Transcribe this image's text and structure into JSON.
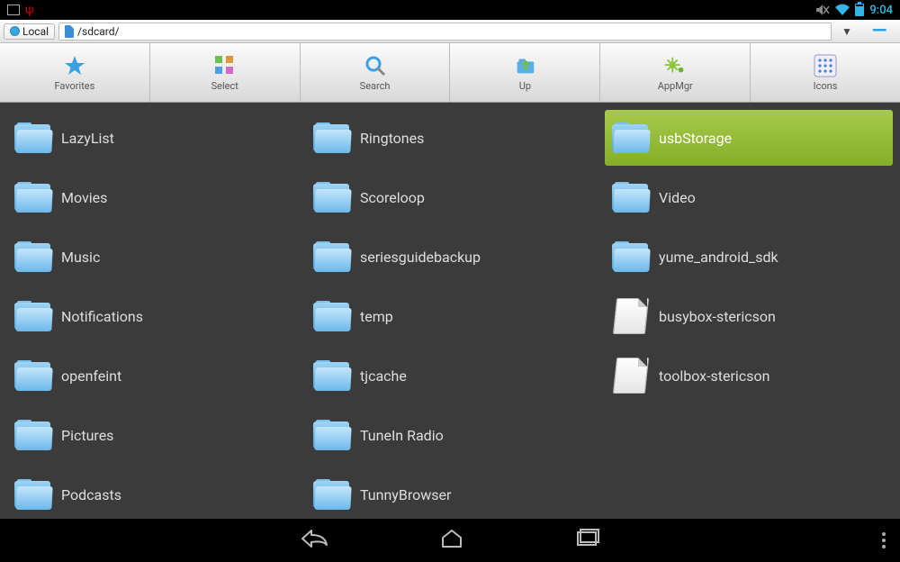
{
  "status": {
    "clock": "9:04"
  },
  "location": {
    "local_label": "Local",
    "path": "/sdcard/"
  },
  "toolbar": [
    {
      "name": "favorites",
      "label": "Favorites"
    },
    {
      "name": "select",
      "label": "Select"
    },
    {
      "name": "search",
      "label": "Search"
    },
    {
      "name": "up",
      "label": "Up"
    },
    {
      "name": "appmgr",
      "label": "AppMgr"
    },
    {
      "name": "icons",
      "label": "Icons"
    }
  ],
  "items": [
    {
      "n": "LazyList",
      "t": "folder",
      "s": false
    },
    {
      "n": "Movies",
      "t": "folder",
      "s": false
    },
    {
      "n": "Music",
      "t": "folder",
      "s": false
    },
    {
      "n": "Notifications",
      "t": "folder",
      "s": false
    },
    {
      "n": "openfeint",
      "t": "folder",
      "s": false
    },
    {
      "n": "Pictures",
      "t": "folder",
      "s": false
    },
    {
      "n": "Podcasts",
      "t": "folder",
      "s": false
    },
    {
      "n": "Ringtones",
      "t": "folder",
      "s": false
    },
    {
      "n": "Scoreloop",
      "t": "folder",
      "s": false
    },
    {
      "n": "seriesguidebackup",
      "t": "folder",
      "s": false
    },
    {
      "n": "temp",
      "t": "folder",
      "s": false
    },
    {
      "n": "tjcache",
      "t": "folder",
      "s": false
    },
    {
      "n": "TuneIn Radio",
      "t": "folder",
      "s": false
    },
    {
      "n": "TunnyBrowser",
      "t": "folder",
      "s": false
    },
    {
      "n": "usbStorage",
      "t": "folder",
      "s": true
    },
    {
      "n": "Video",
      "t": "folder",
      "s": false
    },
    {
      "n": "yume_android_sdk",
      "t": "folder",
      "s": false
    },
    {
      "n": "busybox-stericson",
      "t": "file",
      "s": false
    },
    {
      "n": "toolbox-stericson",
      "t": "file",
      "s": false
    }
  ]
}
